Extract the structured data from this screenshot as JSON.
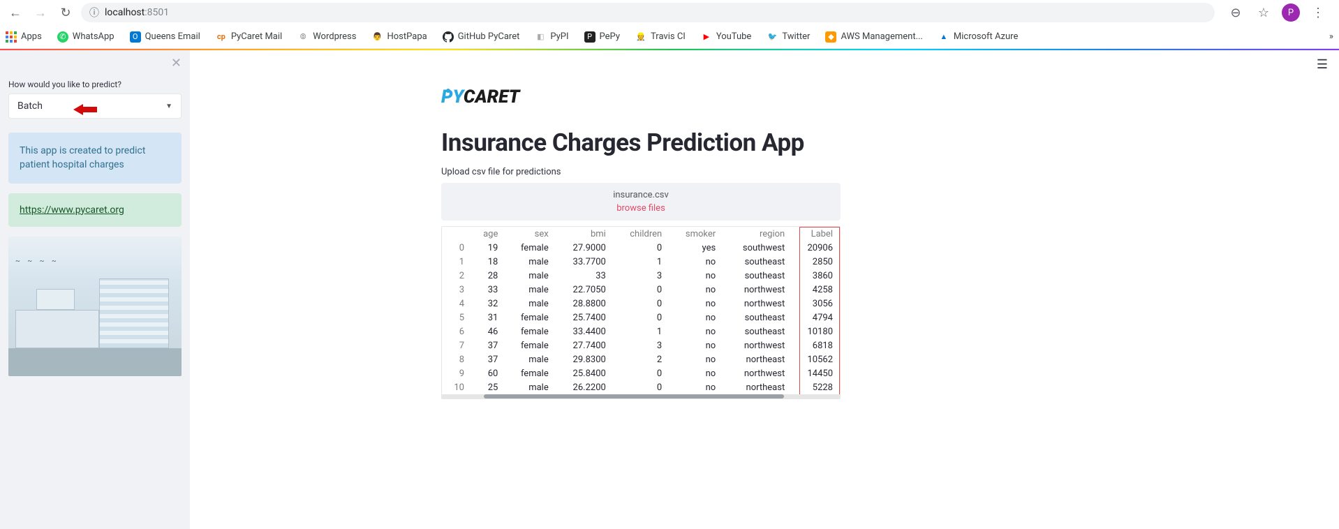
{
  "browser": {
    "url_host": "localhost",
    "url_port": ":8501",
    "avatar_letter": "P"
  },
  "bookmarks": [
    {
      "label": "Apps",
      "icon": "apps"
    },
    {
      "label": "WhatsApp",
      "icon": "whatsapp"
    },
    {
      "label": "Queens Email",
      "icon": "outlook"
    },
    {
      "label": "PyCaret Mail",
      "icon": "pycaret"
    },
    {
      "label": "Wordpress",
      "icon": "wordpress"
    },
    {
      "label": "HostPapa",
      "icon": "hostpapa"
    },
    {
      "label": "GitHub PyCaret",
      "icon": "github"
    },
    {
      "label": "PyPI",
      "icon": "pypi"
    },
    {
      "label": "PePy",
      "icon": "pepy"
    },
    {
      "label": "Travis CI",
      "icon": "travis"
    },
    {
      "label": "YouTube",
      "icon": "youtube"
    },
    {
      "label": "Twitter",
      "icon": "twitter"
    },
    {
      "label": "AWS Management...",
      "icon": "aws"
    },
    {
      "label": "Microsoft Azure",
      "icon": "azure"
    }
  ],
  "sidebar": {
    "select_label": "How would you like to predict?",
    "select_value": "Batch",
    "info_text": "This app is created to predict patient hospital charges",
    "link_text": "https://www.pycaret.org",
    "link_href": "https://www.pycaret.org"
  },
  "main": {
    "title": "Insurance Charges Prediction App",
    "upload_label": "Upload csv file for predictions",
    "uploaded_file": "insurance.csv",
    "browse_text": "browse files"
  },
  "table": {
    "columns": [
      "age",
      "sex",
      "bmi",
      "children",
      "smoker",
      "region",
      "Label"
    ],
    "rows": [
      {
        "idx": "0",
        "age": "19",
        "sex": "female",
        "bmi": "27.9000",
        "children": "0",
        "smoker": "yes",
        "region": "southwest",
        "Label": "20906"
      },
      {
        "idx": "1",
        "age": "18",
        "sex": "male",
        "bmi": "33.7700",
        "children": "1",
        "smoker": "no",
        "region": "southeast",
        "Label": "2850"
      },
      {
        "idx": "2",
        "age": "28",
        "sex": "male",
        "bmi": "33",
        "children": "3",
        "smoker": "no",
        "region": "southeast",
        "Label": "3860"
      },
      {
        "idx": "3",
        "age": "33",
        "sex": "male",
        "bmi": "22.7050",
        "children": "0",
        "smoker": "no",
        "region": "northwest",
        "Label": "4258"
      },
      {
        "idx": "4",
        "age": "32",
        "sex": "male",
        "bmi": "28.8800",
        "children": "0",
        "smoker": "no",
        "region": "northwest",
        "Label": "3056"
      },
      {
        "idx": "5",
        "age": "31",
        "sex": "female",
        "bmi": "25.7400",
        "children": "0",
        "smoker": "no",
        "region": "southeast",
        "Label": "4794"
      },
      {
        "idx": "6",
        "age": "46",
        "sex": "female",
        "bmi": "33.4400",
        "children": "1",
        "smoker": "no",
        "region": "southeast",
        "Label": "10180"
      },
      {
        "idx": "7",
        "age": "37",
        "sex": "female",
        "bmi": "27.7400",
        "children": "3",
        "smoker": "no",
        "region": "northwest",
        "Label": "6818"
      },
      {
        "idx": "8",
        "age": "37",
        "sex": "male",
        "bmi": "29.8300",
        "children": "2",
        "smoker": "no",
        "region": "northeast",
        "Label": "10562"
      },
      {
        "idx": "9",
        "age": "60",
        "sex": "female",
        "bmi": "25.8400",
        "children": "0",
        "smoker": "no",
        "region": "northwest",
        "Label": "14450"
      },
      {
        "idx": "10",
        "age": "25",
        "sex": "male",
        "bmi": "26.2200",
        "children": "0",
        "smoker": "no",
        "region": "northeast",
        "Label": "5228"
      }
    ]
  }
}
